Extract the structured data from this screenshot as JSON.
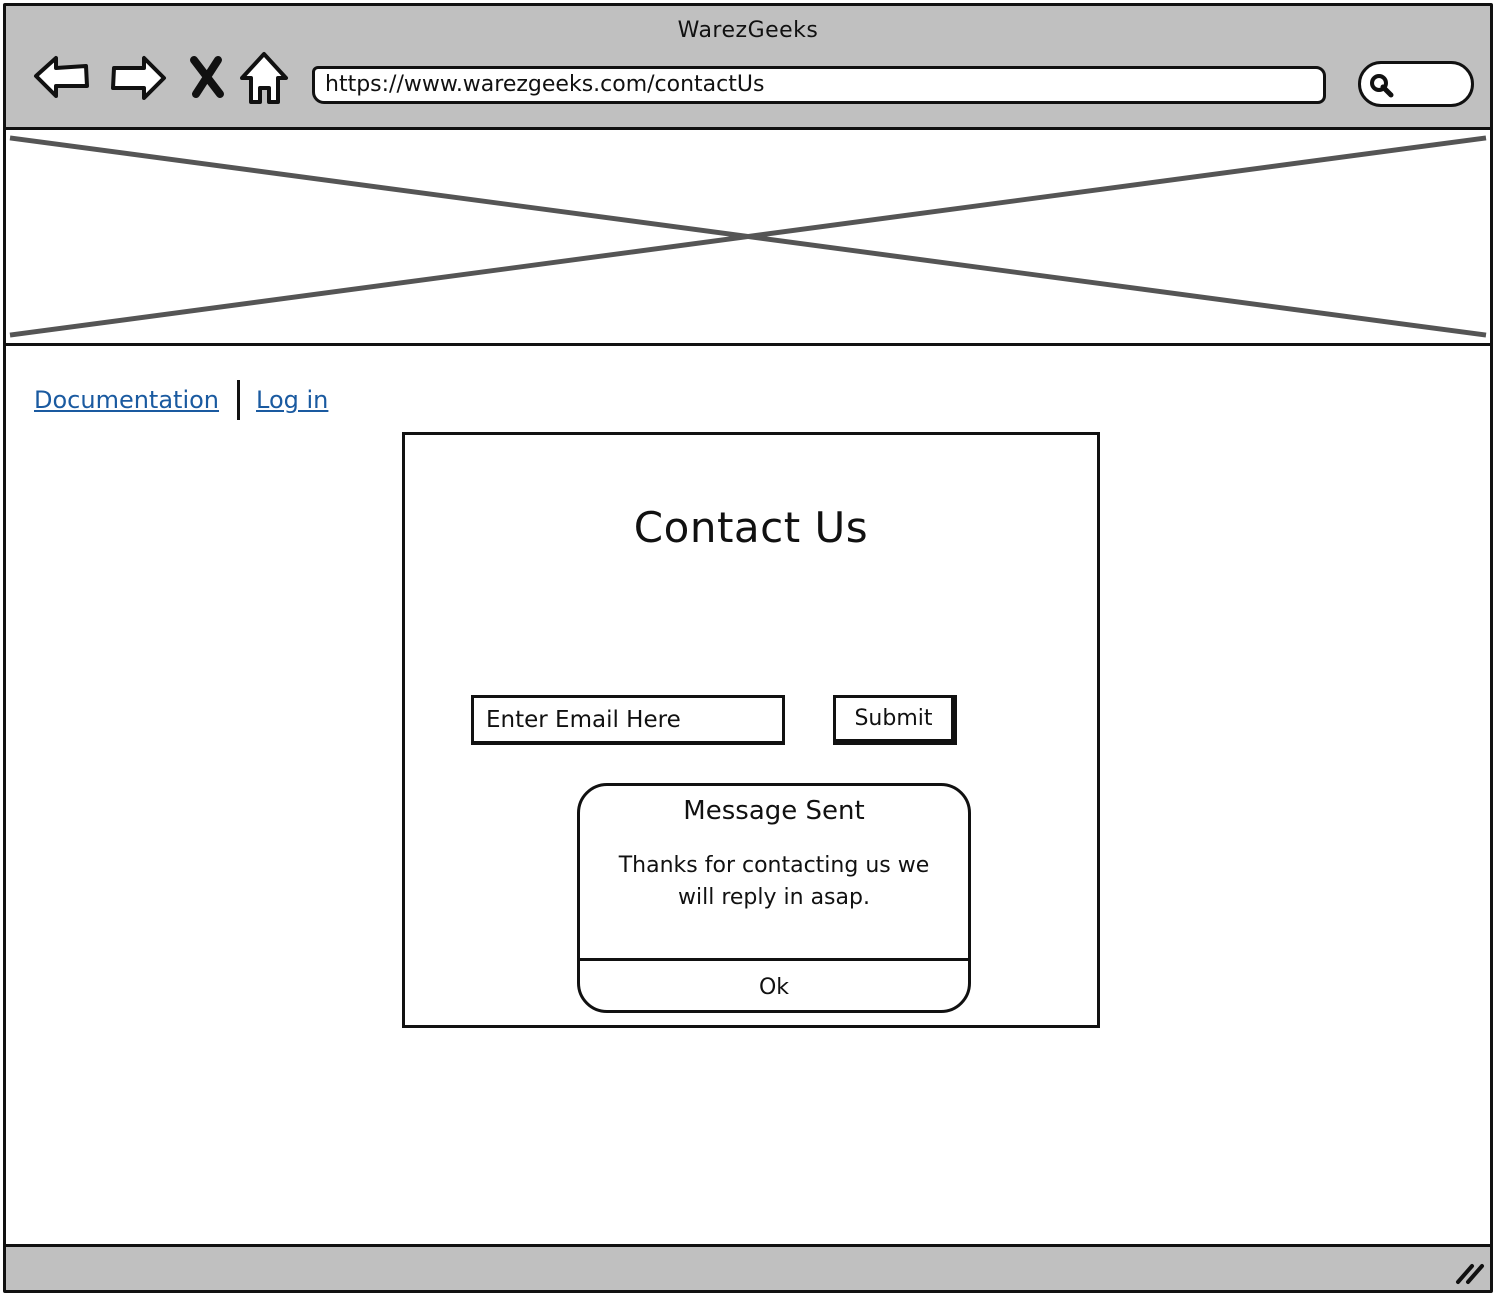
{
  "window": {
    "title": "WarezGeeks"
  },
  "browser": {
    "url": "https://www.warezgeeks.com/contactUs",
    "icons": [
      "back-arrow-icon",
      "forward-arrow-icon",
      "stop-icon",
      "home-icon",
      "search-icon",
      "resize-grip-icon"
    ]
  },
  "nav": {
    "documentation": "Documentation",
    "login": "Log in"
  },
  "contact": {
    "title": "Contact Us",
    "email_placeholder": "Enter Email Here",
    "submit_label": "Submit"
  },
  "dialog": {
    "title": "Message Sent",
    "body": "Thanks for contacting us we will reply in asap.",
    "ok_label": "Ok"
  },
  "colors": {
    "chrome": "#c0c0c0",
    "link": "#1a5aa0",
    "stroke": "#111111"
  }
}
